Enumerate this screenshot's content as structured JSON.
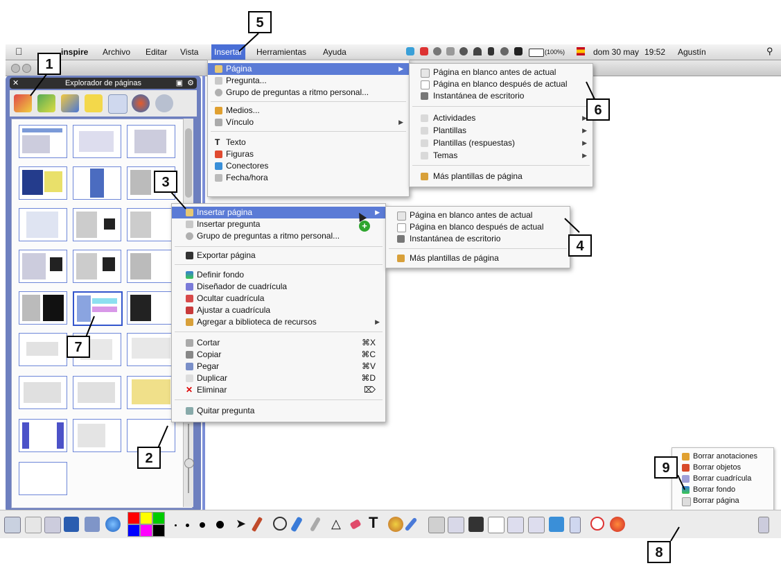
{
  "menubar": {
    "app": "inspire",
    "items": [
      "Archivo",
      "Editar",
      "Vista",
      "Insertar",
      "Herramientas",
      "Ayuda"
    ],
    "status": {
      "battery": "(100%)",
      "date": "dom 30 may",
      "time": "19:52",
      "user": "Agustín"
    }
  },
  "explorer": {
    "title": "Explorador de páginas"
  },
  "insert_menu": {
    "items": [
      "Página",
      "Pregunta...",
      "Grupo de preguntas a ritmo personal...",
      "Medios...",
      "Vínculo",
      "Texto",
      "Figuras",
      "Conectores",
      "Fecha/hora"
    ]
  },
  "page_submenu": {
    "items": [
      "Página en blanco antes de actual",
      "Página en blanco después de actual",
      "Instantánea de escritorio",
      "Actividades",
      "Plantillas",
      "Plantillas (respuestas)",
      "Temas",
      "Más plantillas de página"
    ]
  },
  "context_menu": {
    "items": [
      "Insertar página",
      "Insertar pregunta",
      "Grupo de preguntas a ritmo personal...",
      "Exportar página",
      "Definir fondo",
      "Diseñador de cuadrícula",
      "Ocultar cuadrícula",
      "Ajustar a cuadrícula",
      "Agregar a biblioteca de recursos",
      "Cortar",
      "Copiar",
      "Pegar",
      "Duplicar",
      "Eliminar",
      "Quitar pregunta"
    ],
    "shortcuts": {
      "cut": "⌘X",
      "copy": "⌘C",
      "paste": "⌘V",
      "duplicate": "⌘D",
      "delete": "⌦"
    }
  },
  "insert_page_submenu": {
    "items": [
      "Página en blanco antes de actual",
      "Página en blanco después de actual",
      "Instantánea de escritorio",
      "Más plantillas de página"
    ]
  },
  "delete_popup": {
    "items": [
      "Borrar anotaciones",
      "Borrar objetos",
      "Borrar cuadrícula",
      "Borrar fondo",
      "Borrar página"
    ]
  },
  "callouts": [
    "1",
    "2",
    "3",
    "4",
    "5",
    "6",
    "7",
    "8",
    "9"
  ],
  "colors": {
    "menu_highlight": "#5b7bd6",
    "explorer_bg": "#6d7fbf",
    "palette": [
      "#ff0000",
      "#ffff00",
      "#00cc00",
      "#0000ff",
      "#ff00ff",
      "#000000"
    ]
  }
}
